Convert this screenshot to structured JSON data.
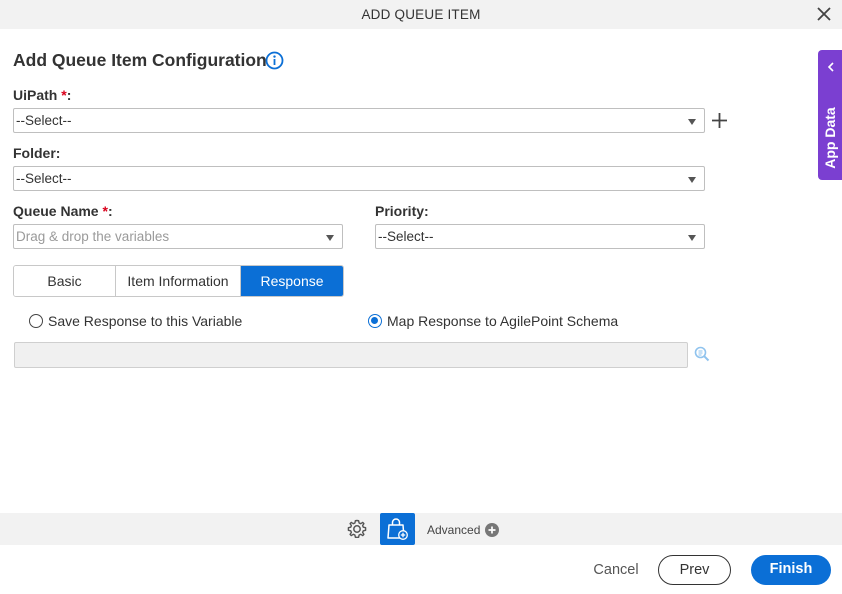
{
  "window": {
    "title": "ADD QUEUE ITEM"
  },
  "page": {
    "heading": "Add Queue Item Configuration"
  },
  "fields": {
    "uipath": {
      "label": "UiPath",
      "required_mark": "*",
      "colon": ":",
      "value": "--Select--"
    },
    "folder": {
      "label": "Folder:",
      "value": "--Select--"
    },
    "queue_name": {
      "label": "Queue Name",
      "required_mark": "*",
      "colon": ":",
      "placeholder": "Drag & drop the variables"
    },
    "priority": {
      "label": "Priority:",
      "value": "--Select--"
    }
  },
  "tabs": [
    {
      "label": "Basic",
      "active": false
    },
    {
      "label": "Item Information",
      "active": false
    },
    {
      "label": "Response",
      "active": true
    }
  ],
  "response": {
    "option_save": "Save Response to this Variable",
    "option_map": "Map Response to AgilePoint Schema",
    "selected": "map"
  },
  "side_panel": {
    "label": "App Data"
  },
  "advanced": {
    "label": "Advanced"
  },
  "footer": {
    "cancel": "Cancel",
    "prev": "Prev",
    "finish": "Finish"
  },
  "colors": {
    "primary": "#0b6fd6",
    "side_tab": "#7b3fd1",
    "required": "#d9001b"
  },
  "icons": [
    "close-icon",
    "info-icon",
    "plus-icon",
    "chevron-left-icon",
    "lookup-icon",
    "gear-icon",
    "shopping-bag-add-icon",
    "circle-plus-icon"
  ]
}
